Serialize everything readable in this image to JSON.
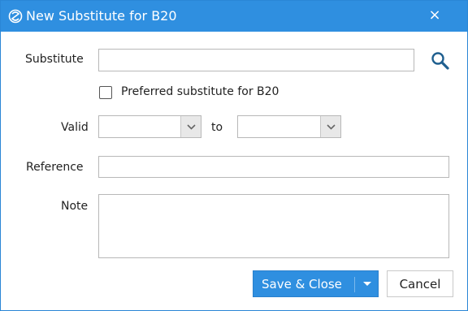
{
  "window": {
    "title": "New Substitute for B20",
    "close_label": "×"
  },
  "form": {
    "substitute_label": "Substitute",
    "substitute_value": "",
    "preferred_label": "Preferred substitute for B20",
    "preferred_checked": false,
    "valid_label": "Valid",
    "valid_from_value": "",
    "to_label": "to",
    "valid_to_value": "",
    "reference_label": "Reference",
    "reference_value": "",
    "note_label": "Note",
    "note_value": ""
  },
  "buttons": {
    "save_close_label": "Save & Close",
    "cancel_label": "Cancel"
  },
  "icons": {
    "app": "app-logo-icon",
    "search": "search-icon",
    "dropdown": "chevron-down-icon",
    "split": "caret-down-icon"
  },
  "colors": {
    "titlebar": "#2f8fe0",
    "primary_button": "#2f8fe0"
  }
}
